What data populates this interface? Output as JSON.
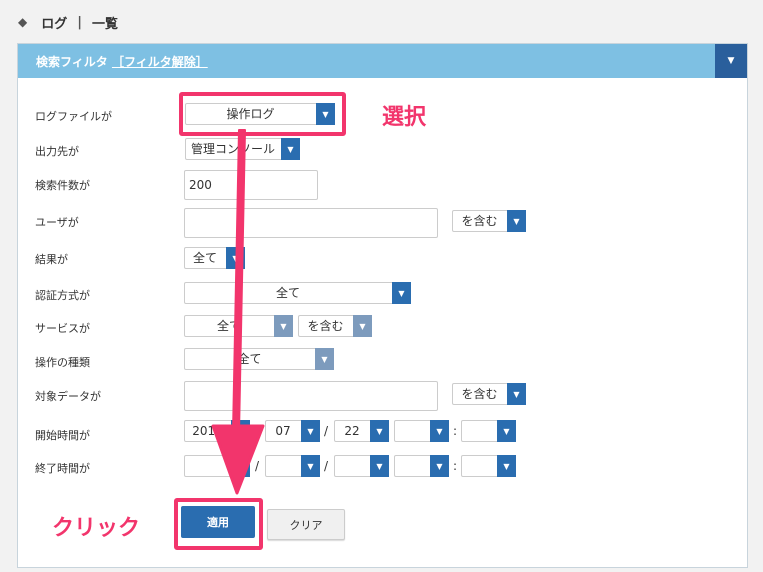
{
  "breadcrumb": {
    "section": "ログ",
    "separator": "|",
    "page": "一覧"
  },
  "filter": {
    "title": "検索フィルタ",
    "clear_link": "［フィルタ解除］",
    "fields": [
      {
        "label": "ログファイルが",
        "value": "操作ログ"
      },
      {
        "label": "出力先が",
        "value": "管理コンソール"
      },
      {
        "label": "検索件数が",
        "value": "200"
      },
      {
        "label": "ユーザが",
        "value": "",
        "match": "を含む"
      },
      {
        "label": "結果が",
        "value": "全て"
      },
      {
        "label": "認証方式が",
        "value": "全て"
      },
      {
        "label": "サービスが",
        "value": "全て",
        "match": "を含む"
      },
      {
        "label": "操作の種類",
        "value": "全て"
      },
      {
        "label": "対象データが",
        "value": "",
        "match": "を含む"
      },
      {
        "label": "開始時間が",
        "year": "2017",
        "month": "07",
        "day": "22",
        "hour": "",
        "minute": ""
      },
      {
        "label": "終了時間が",
        "year": "",
        "month": "",
        "day": "",
        "hour": "",
        "minute": ""
      }
    ],
    "date_sep": "/",
    "time_sep": ":"
  },
  "buttons": {
    "apply": "適用",
    "clear": "クリア"
  },
  "annotations": {
    "select_note": "選択",
    "click_note": "クリック",
    "color": "#f2356c"
  },
  "icons": {
    "breadcrumb": "tag-icon",
    "toggle": "chevron-down-icon",
    "dropdown": "chevron-down-icon",
    "pointer": "arrow-down-icon"
  },
  "colors": {
    "header_bg": "#7ec0e3",
    "accent": "#2a6db0",
    "highlight": "#f2356c"
  }
}
